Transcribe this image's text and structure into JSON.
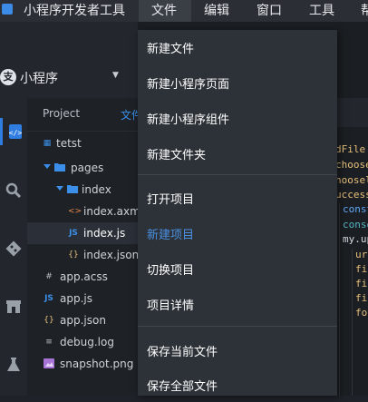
{
  "menubar": {
    "app_name": "小程序开发者工具",
    "items": [
      "文件",
      "编辑",
      "窗口",
      "工具",
      "帮"
    ]
  },
  "selector": {
    "logo_text": "支",
    "label": "小程序"
  },
  "explorer": {
    "tab_project": "Project",
    "tab_files": "文件",
    "tree": [
      {
        "label": "tetst",
        "icon": "grid-icon"
      },
      {
        "label": "pages",
        "icon": "folder-icon"
      },
      {
        "label": "index",
        "icon": "folder-icon"
      },
      {
        "label": "index.axml",
        "icon": "axml-icon"
      },
      {
        "label": "index.js",
        "icon": "js-icon"
      },
      {
        "label": "index.json",
        "icon": "json-icon"
      },
      {
        "label": "app.acss",
        "icon": "css-icon"
      },
      {
        "label": "app.js",
        "icon": "js-icon"
      },
      {
        "label": "app.json",
        "icon": "json-icon"
      },
      {
        "label": "debug.log",
        "icon": "log-icon"
      },
      {
        "label": "snapshot.png",
        "icon": "image-icon"
      }
    ]
  },
  "editor": {
    "code": [
      {
        "text": "dFile",
        "color": "#e6c07b"
      },
      {
        "text": "choose",
        "color": "#e6c07b"
      },
      {
        "text": "hoosel",
        "color": "#e6c07b"
      },
      {
        "text": "uccess",
        "color": "#e6c07b"
      },
      {
        "text": "const",
        "color": "#5fa8f5"
      },
      {
        "text": "conso",
        "color": "#56b6c2"
      },
      {
        "text": "my.up",
        "color": "#d8dce2"
      },
      {
        "text": "ur",
        "color": "#e6c07b"
      },
      {
        "text": "fi",
        "color": "#e6c07b"
      },
      {
        "text": "fi",
        "color": "#e6c07b"
      },
      {
        "text": "fi",
        "color": "#e6c07b"
      },
      {
        "text": "fo",
        "color": "#e6c07b"
      }
    ]
  },
  "file_menu": {
    "items": [
      {
        "label": "新建文件"
      },
      {
        "label": "新建小程序页面"
      },
      {
        "label": "新建小程序组件"
      },
      {
        "label": "新建文件夹"
      },
      {
        "label": "打开项目"
      },
      {
        "label": "新建项目"
      },
      {
        "label": "切换项目"
      },
      {
        "label": "项目详情"
      },
      {
        "label": "保存当前文件"
      },
      {
        "label": "保存全部文件"
      }
    ],
    "highlight_color": "#4a8fe0"
  },
  "colors": {
    "accent": "#2f7de1",
    "background": "#1f2329"
  }
}
